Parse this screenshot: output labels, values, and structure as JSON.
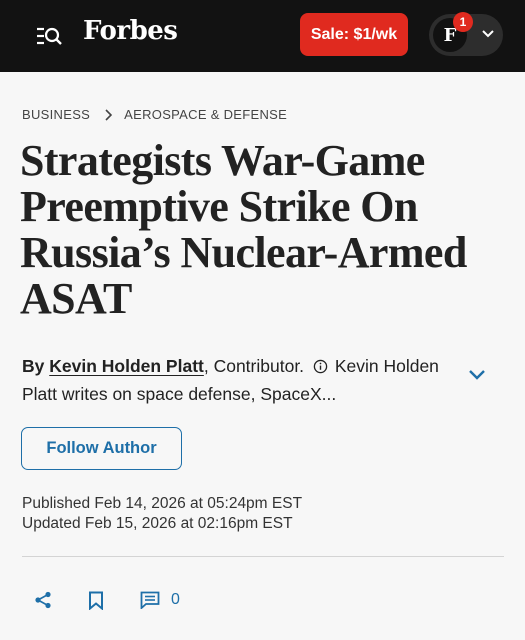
{
  "header": {
    "logo": "Forbes",
    "sale_label": "Sale: $1/wk",
    "avatar_letter": "F",
    "notification_count": "1"
  },
  "breadcrumb": {
    "section": "BUSINESS",
    "subsection": "AEROSPACE & DEFENSE"
  },
  "article": {
    "headline": "Strategists War-Game Preemptive Strike On Russia’s Nuclear-Armed ASAT",
    "byline_prefix": "By",
    "author": "Kevin Holden Platt",
    "author_role": ", Contributor.",
    "author_bio": "Kevin Holden Platt writes on space defense, SpaceX...",
    "follow_label": "Follow Author",
    "published": "Published Feb 14, 2026 at 05:24pm EST",
    "updated": "Updated Feb 15, 2026 at 02:16pm EST"
  },
  "actions": {
    "comment_count": "0"
  },
  "colors": {
    "topbar": "#121212",
    "sale": "#e02a1f",
    "accent": "#1e6fa8"
  }
}
